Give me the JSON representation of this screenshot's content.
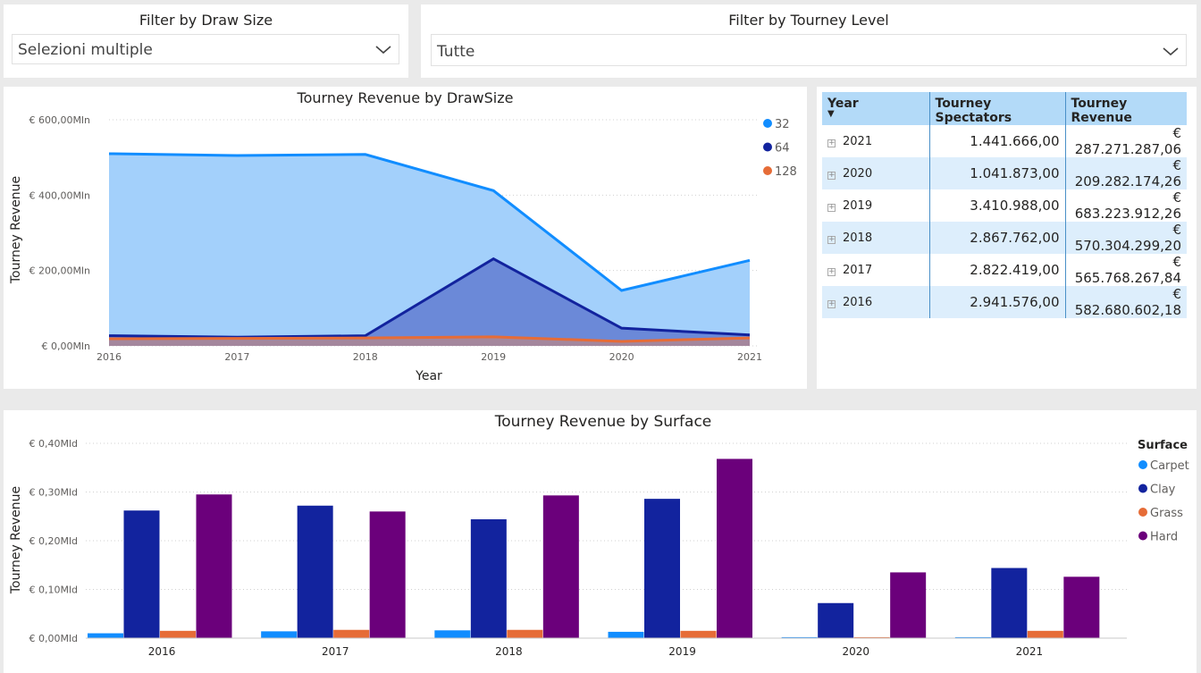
{
  "slicers": {
    "draw_size": {
      "title": "Filter by Draw Size",
      "value": "Selezioni multiple"
    },
    "tourney_level": {
      "title": "Filter by Tourney Level",
      "value": "Tutte"
    }
  },
  "area_chart": {
    "title": "Tourney Revenue by DrawSize",
    "xlabel": "Year",
    "ylabel": "Tourney Revenue",
    "y_ticks": [
      "€ 0,00Mln",
      "€ 200,00Mln",
      "€ 400,00Mln",
      "€ 600,00Mln"
    ],
    "legend": [
      "32",
      "64",
      "128"
    ]
  },
  "matrix": {
    "headers": {
      "year": "Year",
      "spectators": "Tourney Spectators",
      "revenue": "Tourney Revenue"
    },
    "rows": [
      {
        "year": "2021",
        "spectators": "1.441.666,00",
        "revenue": "€ 287.271.287,06"
      },
      {
        "year": "2020",
        "spectators": "1.041.873,00",
        "revenue": "€ 209.282.174,26"
      },
      {
        "year": "2019",
        "spectators": "3.410.988,00",
        "revenue": "€ 683.223.912,26"
      },
      {
        "year": "2018",
        "spectators": "2.867.762,00",
        "revenue": "€ 570.304.299,20"
      },
      {
        "year": "2017",
        "spectators": "2.822.419,00",
        "revenue": "€ 565.768.267,84"
      },
      {
        "year": "2016",
        "spectators": "2.941.576,00",
        "revenue": "€ 582.680.602,18"
      }
    ]
  },
  "bar_chart": {
    "title": "Tourney Revenue by Surface",
    "ylabel": "Tourney Revenue",
    "y_ticks": [
      "€ 0,00Mld",
      "€ 0,10Mld",
      "€ 0,20Mld",
      "€ 0,30Mld",
      "€ 0,40Mld"
    ],
    "legend_title": "Surface"
  },
  "colors": {
    "c32": "#118dff",
    "c64": "#12239e",
    "c128": "#e66c37",
    "hard": "#6b007b"
  },
  "chart_data": [
    {
      "type": "area",
      "title": "Tourney Revenue by DrawSize",
      "xlabel": "Year",
      "ylabel": "Tourney Revenue",
      "x": [
        2016,
        2017,
        2018,
        2019,
        2020,
        2021
      ],
      "ylim": [
        0,
        600
      ],
      "y_unit": "€ Mln",
      "series": [
        {
          "name": "32",
          "values": [
            510,
            505,
            508,
            412,
            147,
            227
          ]
        },
        {
          "name": "64",
          "values": [
            27,
            23,
            27,
            231,
            47,
            29
          ]
        },
        {
          "name": "128",
          "values": [
            19,
            20,
            21,
            24,
            12,
            21
          ]
        }
      ],
      "legend": "right"
    },
    {
      "type": "bar",
      "title": "Tourney Revenue by Surface",
      "ylabel": "Tourney Revenue",
      "categories": [
        "2016",
        "2017",
        "2018",
        "2019",
        "2020",
        "2021"
      ],
      "ylim": [
        0,
        0.4
      ],
      "y_unit": "€ Mld",
      "legend_title": "Surface",
      "series": [
        {
          "name": "Carpet",
          "values": [
            0.01,
            0.014,
            0.016,
            0.013,
            0.002,
            0.002
          ]
        },
        {
          "name": "Clay",
          "values": [
            0.262,
            0.272,
            0.244,
            0.286,
            0.072,
            0.144
          ]
        },
        {
          "name": "Grass",
          "values": [
            0.015,
            0.017,
            0.017,
            0.015,
            0.002,
            0.015
          ]
        },
        {
          "name": "Hard",
          "values": [
            0.295,
            0.26,
            0.293,
            0.368,
            0.135,
            0.126
          ]
        }
      ],
      "legend": "right"
    }
  ]
}
